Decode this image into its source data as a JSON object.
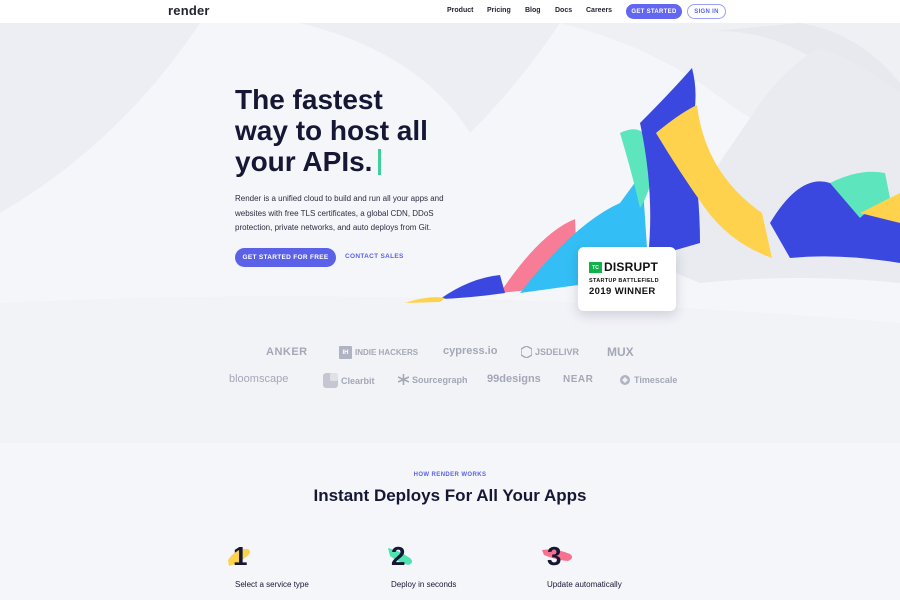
{
  "nav": {
    "logo": "render",
    "links": [
      "Product",
      "Pricing",
      "Blog",
      "Docs",
      "Careers"
    ],
    "get_started": "GET STARTED",
    "sign_in": "SIGN IN"
  },
  "hero": {
    "title_lines": [
      "The fastest",
      "way to host all",
      "your APIs."
    ],
    "description": "Render is a unified cloud to build and run all your apps and websites with free TLS certificates, a global CDN, DDoS protection, private networks, and auto deploys from Git.",
    "cta_primary": "GET STARTED FOR FREE",
    "cta_secondary": "CONTACT SALES"
  },
  "badge": {
    "tc": "TC",
    "title": "DISRUPT",
    "subtitle": "STARTUP BATTLEFIELD",
    "winner": "2019 WINNER"
  },
  "logos": {
    "row1": [
      "ANKER",
      "INDIE HACKERS",
      "cypress.io",
      "JSDELIVR",
      "MUX"
    ],
    "row2": [
      "bloomscape",
      "Clearbit",
      "Sourcegraph",
      "99designs",
      "NEAR",
      "Timescale"
    ],
    "indie_mark": "IH"
  },
  "how": {
    "eyebrow": "HOW RENDER WORKS",
    "title": "Instant Deploys For All Your Apps",
    "steps": [
      {
        "num": "1",
        "label": "Select a service type",
        "color": "#ffd24d"
      },
      {
        "num": "2",
        "label": "Deploy in seconds",
        "color": "#4fe3b2"
      },
      {
        "num": "3",
        "label": "Update automatically",
        "color": "#f7728f"
      }
    ]
  },
  "colors": {
    "brand": "#5b62e8",
    "accent_green": "#3ecf9a",
    "blue": "#3a48e0",
    "yellow": "#ffd24d",
    "mint": "#5de5be",
    "pink": "#f77c96",
    "sky": "#33bff5"
  }
}
